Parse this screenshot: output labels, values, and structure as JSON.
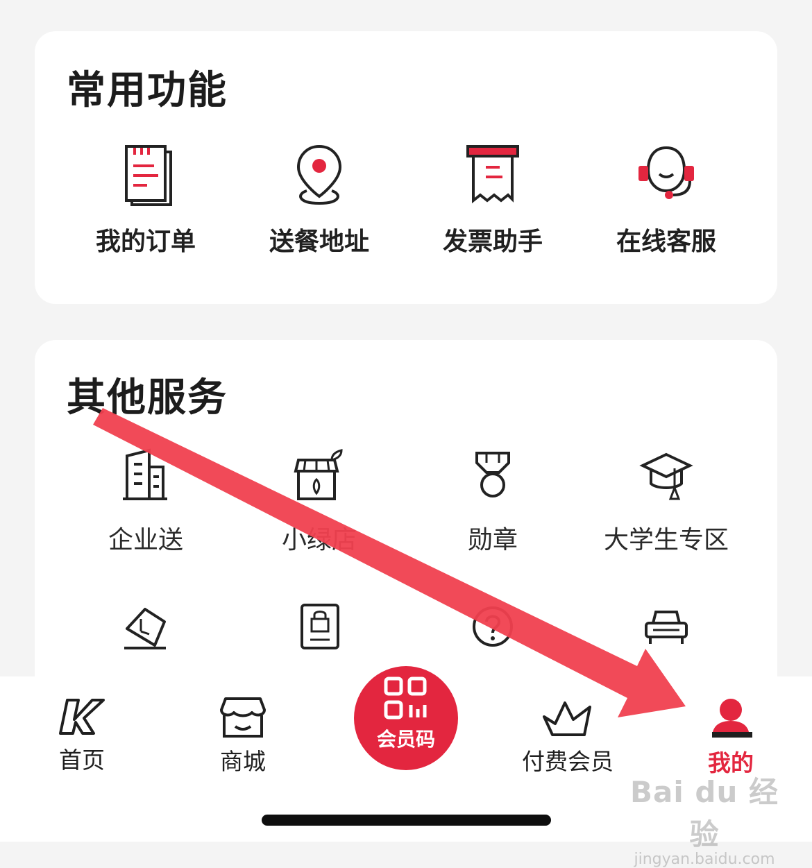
{
  "common_functions": {
    "title": "常用功能",
    "items": [
      {
        "label": "我的订单",
        "icon": "order-list-icon"
      },
      {
        "label": "送餐地址",
        "icon": "location-pin-icon"
      },
      {
        "label": "发票助手",
        "icon": "invoice-icon"
      },
      {
        "label": "在线客服",
        "icon": "customer-service-icon"
      }
    ]
  },
  "other_services": {
    "title": "其他服务",
    "items": [
      {
        "label": "企业送",
        "icon": "building-icon"
      },
      {
        "label": "小绿店",
        "icon": "green-store-icon"
      },
      {
        "label": "勋章",
        "icon": "medal-icon"
      },
      {
        "label": "大学生专区",
        "icon": "graduation-cap-icon"
      }
    ],
    "partial_icons": [
      "clock-tag-icon",
      "locked-document-icon",
      "help-question-icon",
      "car-icon"
    ]
  },
  "tabbar": {
    "items": [
      {
        "label": "首页",
        "icon": "k-logo-icon",
        "active": false
      },
      {
        "label": "商城",
        "icon": "storefront-icon",
        "active": false
      },
      {
        "label": "会员码",
        "icon": "qr-code-icon",
        "active": false
      },
      {
        "label": "付费会员",
        "icon": "crown-icon",
        "active": false
      },
      {
        "label": "我的",
        "icon": "user-icon",
        "active": true
      }
    ]
  },
  "watermark": {
    "main": "Bai du 经验",
    "sub": "jingyan.baidu.com"
  },
  "colors": {
    "accent": "#e3263f",
    "arrow": "#f0404f",
    "background": "#f4f4f4",
    "card": "#ffffff"
  }
}
